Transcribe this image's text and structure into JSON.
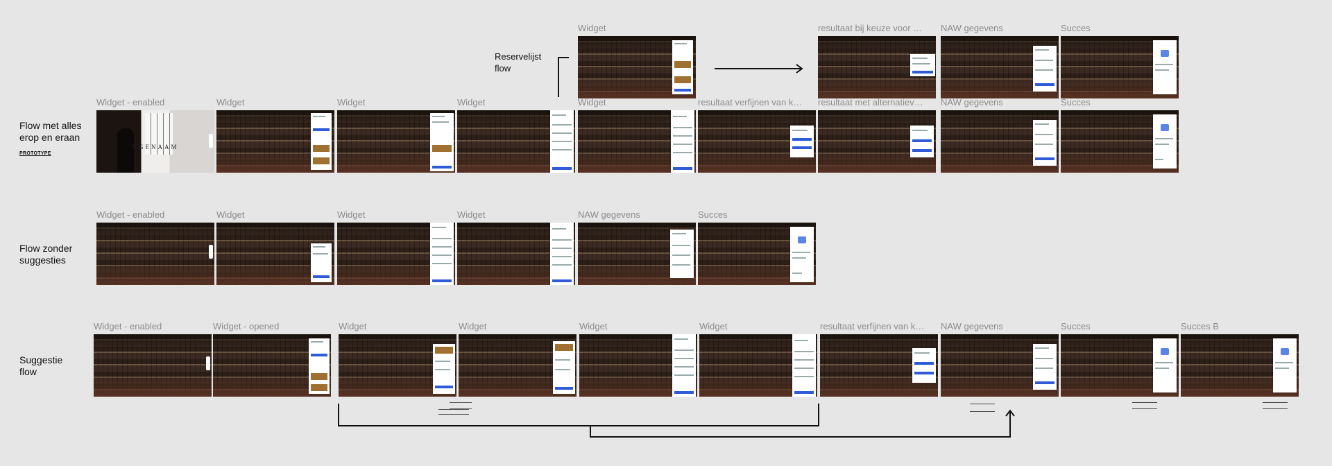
{
  "rows": [
    {
      "label": "Flow met alles erop en eraan",
      "sublabel": "PROTOTYPE"
    },
    {
      "label": "Flow zonder suggesties"
    },
    {
      "label": "Suggestie flow"
    }
  ],
  "reservelijst": {
    "label": "Reservelijst flow",
    "frames": [
      "Widget",
      "resultaat bij keuze voor …",
      "NAW gegevens",
      "Succes"
    ]
  },
  "row1_frames": [
    "Widget - enabled",
    "Widget",
    "Widget",
    "Widget",
    "Widget",
    "resultaat verfijnen van k…",
    "resultaat met alternatiev…",
    "NAW gegevens",
    "Succes"
  ],
  "row2_frames": [
    "Widget - enabled",
    "Widget",
    "Widget",
    "Widget",
    "NAW gegevens",
    "Succes"
  ],
  "row3_frames": [
    "Widget - enabled",
    "Widget - opened",
    "Widget",
    "Widget",
    "Widget",
    "Widget",
    "resultaat verfijnen van k…",
    "NAW gegevens",
    "Succes",
    "Succes B"
  ],
  "hero_brand": "NGENAAM"
}
